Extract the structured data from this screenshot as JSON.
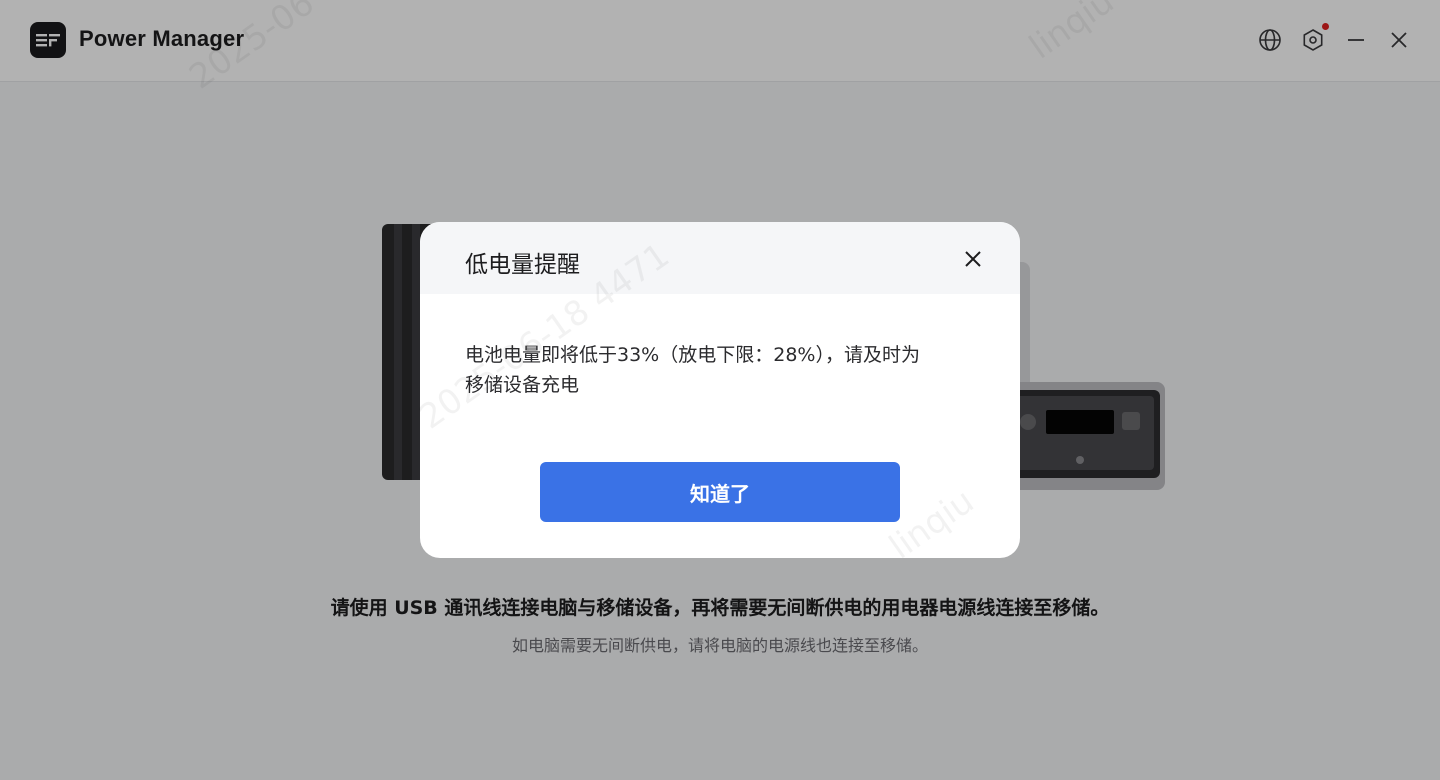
{
  "app": {
    "title": "Power Manager",
    "logo_text": "EF"
  },
  "titlebar": {
    "icons": [
      "globe-icon",
      "settings-icon",
      "minimize-icon",
      "close-icon"
    ],
    "notification_dot_color": "#e02020"
  },
  "main": {
    "instruction": "请使用 USB 通讯线连接电脑与移储设备，再将需要无间断供电的用电器电源线连接至移储。",
    "sub_instruction": "如电脑需要无间断供电，请将电脑的电源线也连接至移储。"
  },
  "dialog": {
    "title": "低电量提醒",
    "message_line1": "电池电量即将低于33%（放电下限：28%），请及时为",
    "message_line2": "移储设备充电",
    "button_label": "知道了"
  },
  "colors": {
    "primary_button": "#3a72e6",
    "overlay": "rgba(0,0,0,0.30)"
  }
}
